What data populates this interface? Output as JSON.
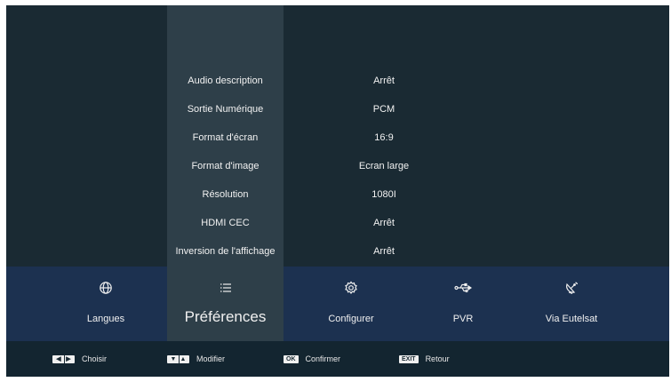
{
  "settings": [
    {
      "label": "Audio description",
      "value": "Arrêt"
    },
    {
      "label": "Sortie Numérique",
      "value": "PCM"
    },
    {
      "label": "Format d'écran",
      "value": "16:9"
    },
    {
      "label": "Format d'image",
      "value": "Ecran large"
    },
    {
      "label": "Résolution",
      "value": "1080I"
    },
    {
      "label": "HDMI CEC",
      "value": "Arrêt"
    },
    {
      "label": "Inversion de l'affichage",
      "value": "Arrêt"
    }
  ],
  "tabs": [
    {
      "label": "Langues",
      "icon": "globe-icon"
    },
    {
      "label": "Préférences",
      "icon": "list-icon",
      "active": true
    },
    {
      "label": "Configurer",
      "icon": "gear-icon"
    },
    {
      "label": "PVR",
      "icon": "usb-icon"
    },
    {
      "label": "Via Eutelsat",
      "icon": "satellite-dish-icon"
    }
  ],
  "footer": {
    "choose": {
      "label": "Choisir",
      "key": "left-right-arrows"
    },
    "modify": {
      "label": "Modifier",
      "key": "down-up-arrows"
    },
    "confirm": {
      "label": "Confirmer",
      "key": "OK"
    },
    "back": {
      "label": "Retour",
      "key": "EXIT"
    }
  },
  "colors": {
    "background": "#1a2a33",
    "selected_column": "#2e3f49",
    "tab_bar": "#1c3150",
    "footer": "#132530",
    "text": "#f2f2f2"
  }
}
